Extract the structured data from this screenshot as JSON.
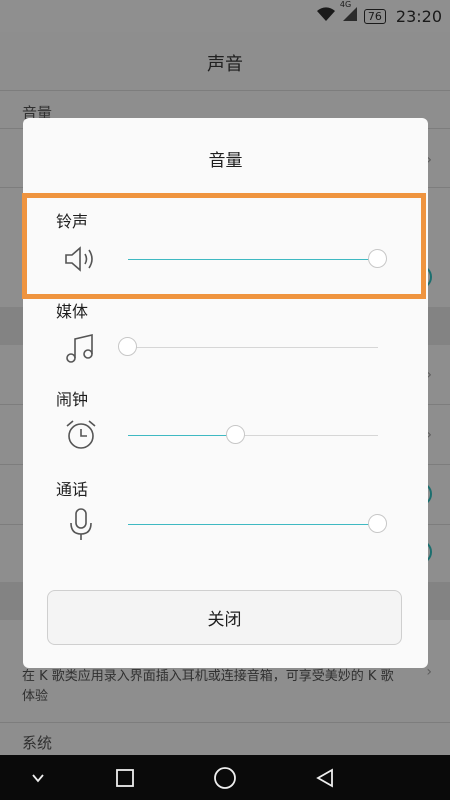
{
  "status_bar": {
    "network": "4G",
    "battery": "76",
    "time": "23:20"
  },
  "background": {
    "title": "声音",
    "section_volume": "音量",
    "description": "在 K 歌类应用录入界面插入耳机或连接音箱，可享受美妙的 K 歌体验",
    "section_system": "系统"
  },
  "dialog": {
    "title": "音量",
    "rows": [
      {
        "label": "铃声",
        "icon": "speaker-icon",
        "value_percent": 100
      },
      {
        "label": "媒体",
        "icon": "music-note-icon",
        "value_percent": 0
      },
      {
        "label": "闹钟",
        "icon": "alarm-clock-icon",
        "value_percent": 43
      },
      {
        "label": "通话",
        "icon": "microphone-icon",
        "value_percent": 100
      }
    ],
    "close_label": "关闭"
  },
  "colors": {
    "accent": "#3fb9c2",
    "highlight": "#ef943f",
    "dim_background": "#8e8e8e"
  }
}
